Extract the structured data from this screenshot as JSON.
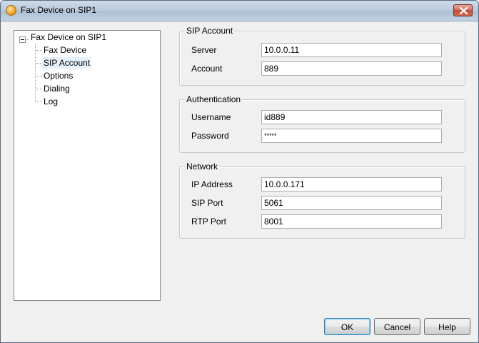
{
  "window": {
    "title": "Fax Device on SIP1"
  },
  "tree": {
    "root": "Fax Device on SIP1",
    "items": [
      "Fax Device",
      "SIP Account",
      "Options",
      "Dialing",
      "Log"
    ],
    "selected": "SIP Account"
  },
  "sip_account": {
    "title": "SIP Account",
    "server_label": "Server",
    "server_value": "10.0.0.11",
    "account_label": "Account",
    "account_value": "889"
  },
  "authentication": {
    "title": "Authentication",
    "username_label": "Username",
    "username_value": "id889",
    "password_label": "Password",
    "password_value": "*****"
  },
  "network": {
    "title": "Network",
    "ip_label": "IP Address",
    "ip_value": "10.0.0.171",
    "sip_port_label": "SIP Port",
    "sip_port_value": "5061",
    "rtp_port_label": "RTP Port",
    "rtp_port_value": "8001"
  },
  "buttons": {
    "ok": "OK",
    "cancel": "Cancel",
    "help": "Help"
  },
  "icons": {
    "app": "fax-app-icon",
    "close": "close-icon",
    "expander": "collapse-icon"
  }
}
